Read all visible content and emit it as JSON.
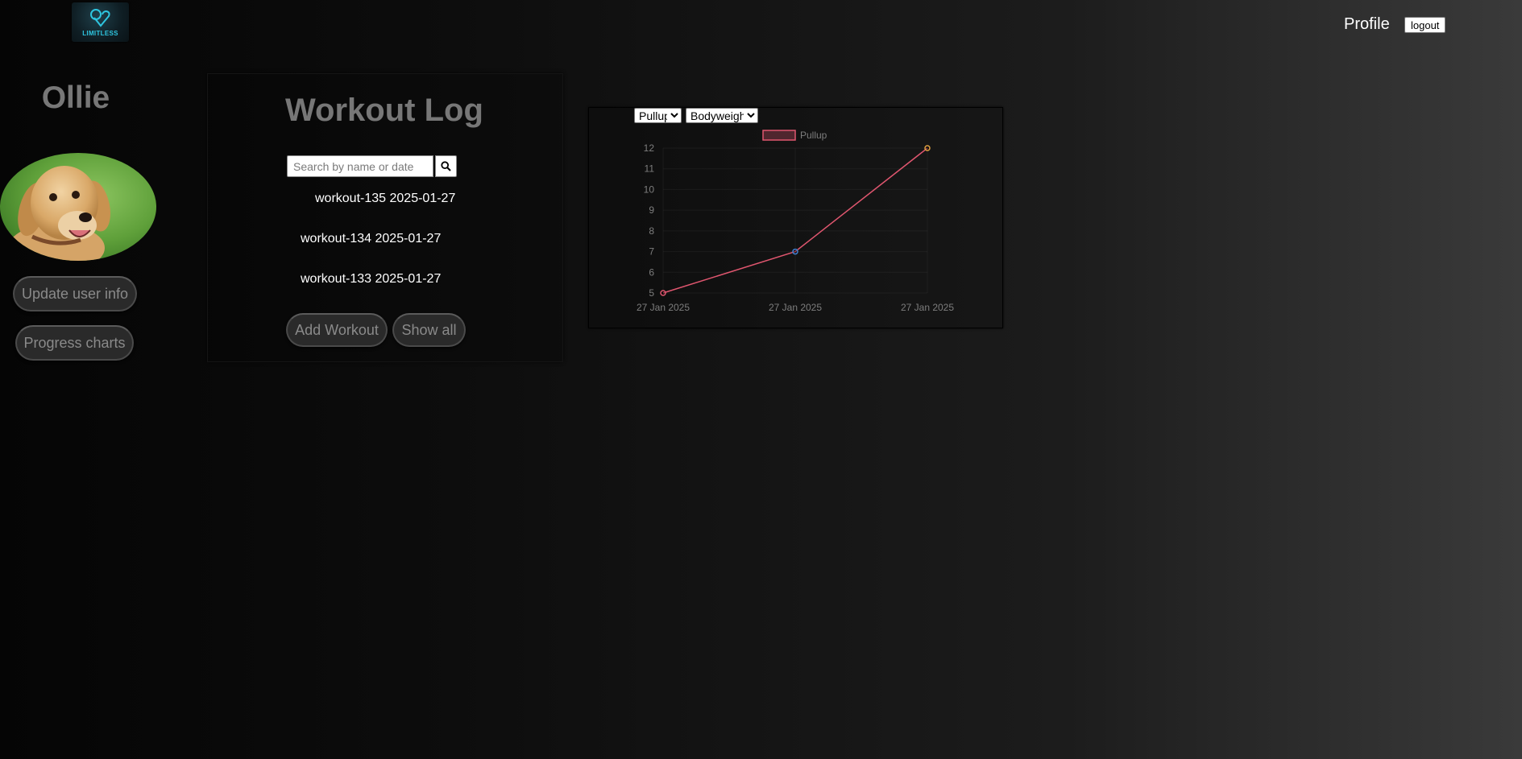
{
  "header": {
    "logo_text": "LIMITLESS",
    "profile_label": "Profile",
    "logout_label": "logout"
  },
  "sidebar": {
    "username": "Ollie",
    "update_button": "Update user info",
    "progress_button": "Progress charts"
  },
  "workout_log": {
    "title": "Workout Log",
    "search_placeholder": "Search by name or date",
    "items": [
      "workout-135 2025-01-27",
      "workout-134 2025-01-27",
      "workout-133 2025-01-27"
    ],
    "add_button": "Add Workout",
    "show_all_button": "Show all"
  },
  "chart_controls": {
    "exercise_selected": "Pullup",
    "type_selected": "Bodyweight"
  },
  "colors": {
    "line": "#e0566f",
    "point_colors": [
      "#e0566f",
      "#3f7fd0",
      "#e0a040"
    ]
  },
  "chart_data": {
    "type": "line",
    "x": [
      "27 Jan 2025",
      "27 Jan 2025",
      "27 Jan 2025"
    ],
    "series": [
      {
        "name": "Pullup",
        "values": [
          5,
          7,
          12
        ]
      }
    ],
    "ylim": [
      5,
      12
    ],
    "yticks": [
      5,
      6,
      7,
      8,
      9,
      10,
      11,
      12
    ],
    "legend": "top",
    "grid": true
  }
}
